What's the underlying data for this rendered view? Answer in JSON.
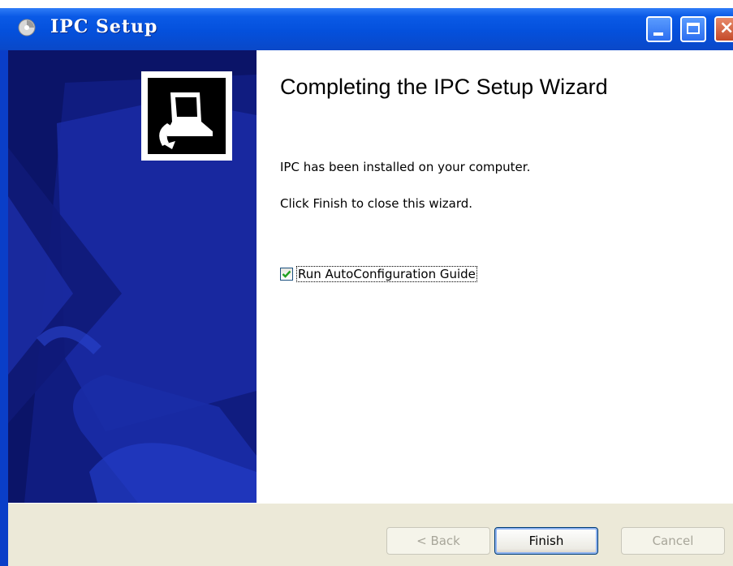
{
  "window": {
    "title": "IPC Setup",
    "colors": {
      "titlebar": "#0a50dc",
      "sidebar": "#0b1468",
      "footer": "#ece9d8"
    }
  },
  "titlebar_buttons": {
    "minimize_icon": "minimize-icon",
    "maximize_icon": "maximize-icon",
    "close_icon": "close-icon"
  },
  "sidebar": {
    "logo_icon": "installer-computer-icon"
  },
  "main": {
    "heading": "Completing the IPC Setup Wizard",
    "message_installed": "IPC has been installed on your computer.",
    "message_finish": "Click Finish to close this wizard.",
    "checkbox": {
      "label": "Run AutoConfiguration Guide",
      "checked": true
    }
  },
  "footer": {
    "back_label": "< Back",
    "finish_label": "Finish",
    "cancel_label": "Cancel"
  }
}
